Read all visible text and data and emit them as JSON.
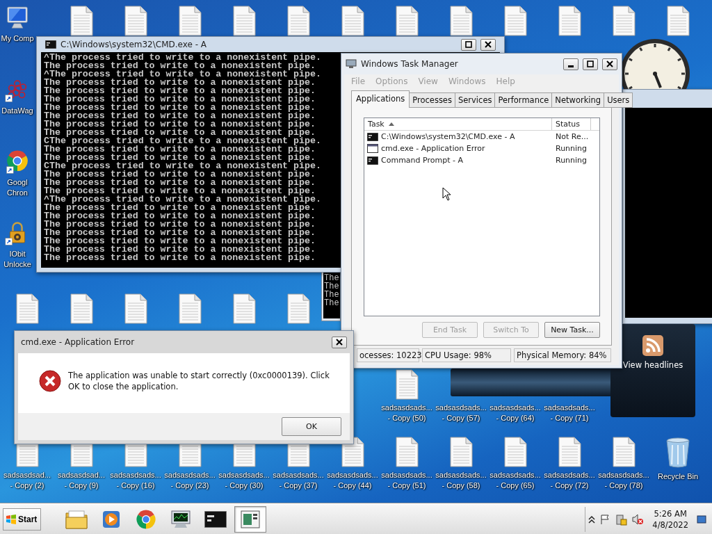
{
  "desktop_icons": [
    {
      "kind": "computer",
      "lines": [
        "My Comp"
      ]
    },
    {
      "kind": "file"
    },
    {
      "kind": "file"
    },
    {
      "kind": "file"
    },
    {
      "kind": "file"
    },
    {
      "kind": "file"
    },
    {
      "kind": "file"
    },
    {
      "kind": "file"
    },
    {
      "kind": "file"
    },
    {
      "kind": "file"
    },
    {
      "kind": "file"
    },
    {
      "kind": "file"
    },
    {
      "kind": "file"
    },
    {
      "kind": "molecule",
      "lines": [
        "DataWag"
      ]
    },
    {
      "kind": "chrome",
      "lines": [
        "Googl",
        "Chron"
      ]
    },
    {
      "kind": "lock",
      "lines": [
        "IObit",
        "Unlocke"
      ]
    },
    {
      "kind": "file"
    },
    {
      "kind": "file"
    },
    {
      "kind": "file"
    },
    {
      "kind": "file"
    },
    {
      "kind": "file"
    },
    {
      "kind": "file"
    },
    {
      "kind": "file",
      "lines": [
        "sadsasdsads...",
        "- Copy (50)"
      ]
    },
    {
      "kind": "label",
      "lines": [
        "sadsasdsads...",
        "- Copy (57)"
      ]
    },
    {
      "kind": "label",
      "lines": [
        "sadsasdsads...",
        "- Copy (64)"
      ]
    },
    {
      "kind": "label",
      "lines": [
        "sadsasdsads...",
        "- Copy (71)"
      ]
    },
    {
      "kind": "file",
      "lines": [
        "sadsasdsad...",
        "- Copy (2)"
      ]
    },
    {
      "kind": "file",
      "lines": [
        "sadsasdsad...",
        "- Copy (9)"
      ]
    },
    {
      "kind": "file",
      "lines": [
        "sadsasdsads...",
        "- Copy (16)"
      ]
    },
    {
      "kind": "file",
      "lines": [
        "sadsasdsads...",
        "- Copy (23)"
      ]
    },
    {
      "kind": "file",
      "lines": [
        "sadsasdsads...",
        "- Copy (30)"
      ]
    },
    {
      "kind": "file",
      "lines": [
        "sadsasdsads...",
        "- Copy (37)"
      ]
    },
    {
      "kind": "file",
      "lines": [
        "sadsasdsads...",
        "- Copy (44)"
      ]
    },
    {
      "kind": "file",
      "lines": [
        "sadsasdsads...",
        "- Copy (51)"
      ]
    },
    {
      "kind": "file",
      "lines": [
        "sadsasdsads...",
        "- Copy (58)"
      ]
    },
    {
      "kind": "file",
      "lines": [
        "sadsasdsads...",
        "- Copy (65)"
      ]
    },
    {
      "kind": "file",
      "lines": [
        "sadsasdsads...",
        "- Copy (72)"
      ]
    },
    {
      "kind": "file",
      "lines": [
        "sadsasdsads...",
        "- Copy (78)"
      ]
    },
    {
      "kind": "recycle",
      "lines": [
        "Recycle Bin"
      ]
    }
  ],
  "cmd_window": {
    "title": "C:\\Windows\\system32\\CMD.exe - A",
    "lines": [
      "^The process tried to write to a nonexistent pipe.",
      "The process tried to write to a nonexistent pipe.",
      "^The process tried to write to a nonexistent pipe.",
      "The process tried to write to a nonexistent pipe.",
      "The process tried to write to a nonexistent pipe.",
      "The process tried to write to a nonexistent pipe.",
      "The process tried to write to a nonexistent pipe.",
      "The process tried to write to a nonexistent pipe.",
      "The process tried to write to a nonexistent pipe.",
      "The process tried to write to a nonexistent pipe.",
      "CThe process tried to write to a nonexistent pipe.",
      "The process tried to write to a nonexistent pipe.",
      "The process tried to write to a nonexistent pipe.",
      "CThe process tried to write to a nonexistent pipe.",
      "The process tried to write to a nonexistent pipe.",
      "The process tried to write to a nonexistent pipe.",
      "The process tried to write to a nonexistent pipe.",
      "^The process tried to write to a nonexistent pipe.",
      "The process tried to write to a nonexistent pipe.",
      "The process tried to write to a nonexistent pipe.",
      "The process tried to write to a nonexistent pipe.",
      "The process tried to write to a nonexistent pipe.",
      "The process tried to write to a nonexistent pipe.",
      "The process tried to write to a nonexistent pipe.",
      "The process tried to write to a nonexistent pipe."
    ]
  },
  "console_fragment": {
    "lines": [
      "The",
      "The",
      "The",
      "The"
    ]
  },
  "task_manager": {
    "title": "Windows Task Manager",
    "menu": [
      {
        "label": "File",
        "disabled": true
      },
      {
        "label": "Options",
        "disabled": true
      },
      {
        "label": "View",
        "disabled": true
      },
      {
        "label": "Windows",
        "disabled": true
      },
      {
        "label": "Help",
        "disabled": true
      }
    ],
    "tabs": [
      {
        "label": "Applications",
        "selected": true
      },
      {
        "label": "Processes",
        "selected": false
      },
      {
        "label": "Services",
        "selected": false
      },
      {
        "label": "Performance",
        "selected": false
      },
      {
        "label": "Networking",
        "selected": false
      },
      {
        "label": "Users",
        "selected": false
      }
    ],
    "columns": [
      "Task",
      "Status"
    ],
    "rows": [
      {
        "kind": "console",
        "task": "C:\\Windows\\system32\\CMD.exe - A",
        "status": "Not Re..."
      },
      {
        "kind": "window",
        "task": "cmd.exe - Application Error",
        "status": "Running"
      },
      {
        "kind": "prompt",
        "task": "Command Prompt - A",
        "status": "Running"
      }
    ],
    "buttons": [
      {
        "label": "End Task",
        "disabled": true
      },
      {
        "label": "Switch To",
        "disabled": true
      },
      {
        "label": "New Task...",
        "disabled": false
      }
    ],
    "status_bar": [
      "ocesses: 10223",
      "CPU Usage: 98%",
      "Physical Memory: 84%"
    ]
  },
  "error_dialog": {
    "title": "cmd.exe - Application Error",
    "message": "The application was unable to start correctly (0xc0000139). Click OK to close the application.",
    "button": "OK"
  },
  "feed_gadget": {
    "label": "View headlines"
  },
  "taskbar": {
    "start": "Start",
    "apps": [
      {
        "kind": "folder",
        "selected": false
      },
      {
        "kind": "media",
        "selected": false
      },
      {
        "kind": "chrome",
        "selected": false
      },
      {
        "kind": "monitor",
        "selected": false
      },
      {
        "kind": "console",
        "selected": false
      },
      {
        "kind": "window",
        "selected": true
      }
    ],
    "time": "5:26 AM",
    "date": "4/8/2022"
  }
}
